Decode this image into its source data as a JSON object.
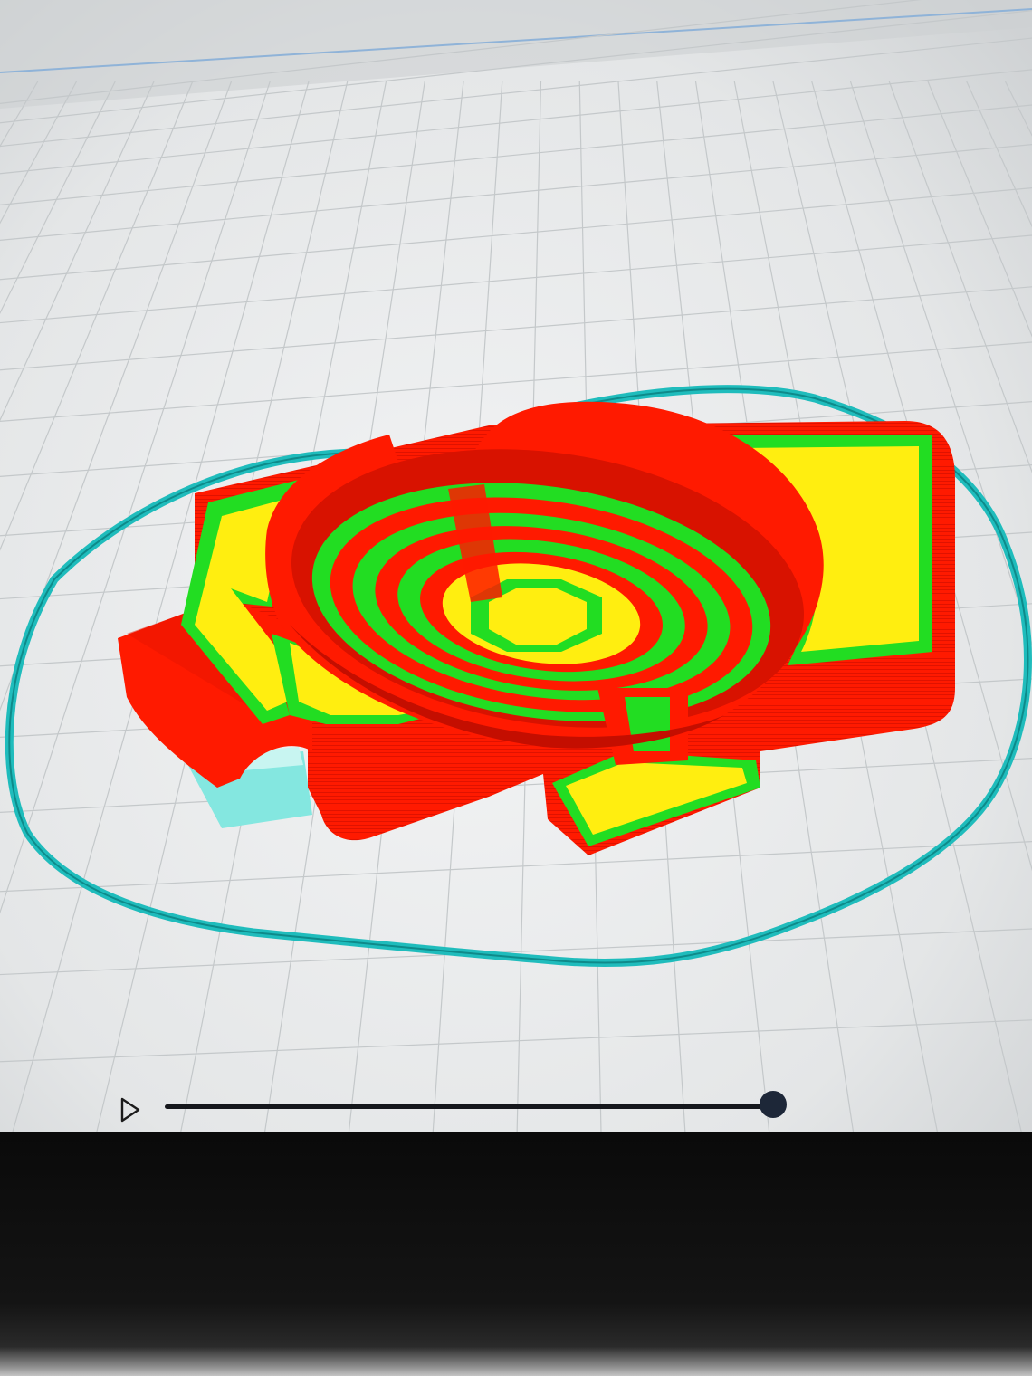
{
  "app": {
    "view": "slice-preview",
    "icons": [
      "play-icon"
    ]
  },
  "colors": {
    "build_plate": "#e9ebec",
    "grid_line": "#c4c8ca",
    "outer_wall": "#ff1a00",
    "inner_wall": "#22dd22",
    "top_bottom_infill": "#ffee10",
    "skirt_support": "#1fbcbc",
    "support": "#84e7e0",
    "slider_thumb": "#1d2738",
    "slider_track": "#15171c"
  },
  "layer_slider": {
    "progress": 1.0
  }
}
